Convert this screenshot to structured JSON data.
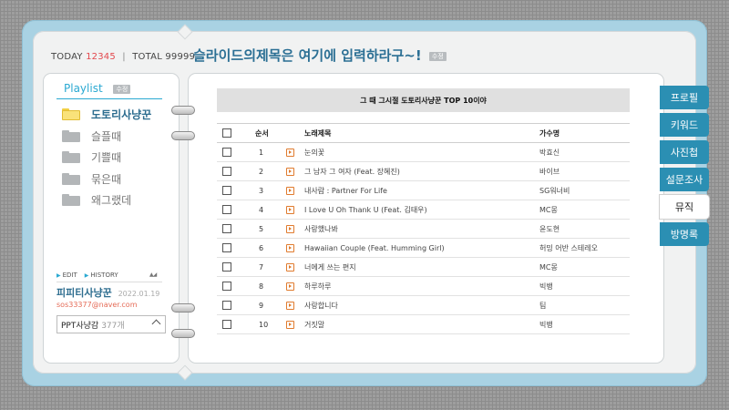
{
  "counter": {
    "today_label": "TODAY",
    "today_value": "12345",
    "separator": "|",
    "total_label": "TOTAL",
    "total_value": "99999"
  },
  "header": {
    "title": "슬라이드의제목은 여기에 입력하라구~!",
    "edit_badge": "수정"
  },
  "sidebar": {
    "playlist_title": "Playlist",
    "edit_badge": "수정",
    "folders": [
      {
        "label": "도토리사냥꾼",
        "active": true
      },
      {
        "label": "슬플때",
        "active": false
      },
      {
        "label": "기쁠때",
        "active": false
      },
      {
        "label": "묶은때",
        "active": false
      },
      {
        "label": "왜그랬데",
        "active": false
      }
    ],
    "links": {
      "edit": "EDIT",
      "history": "HISTORY"
    },
    "profile": {
      "name": "피피티사냥꾼",
      "date": "2022.01.19",
      "email": "sos33377@naver.com"
    },
    "dropdown": {
      "label": "PPT사냥감",
      "count": "377개"
    }
  },
  "main": {
    "header": "그 때 그시절 도토리사냥꾼 TOP 10이야",
    "columns": {
      "num": "순서",
      "title": "노래제목",
      "artist": "가수명"
    },
    "songs": [
      {
        "num": "1",
        "title": "눈의꽃",
        "artist": "박효신"
      },
      {
        "num": "2",
        "title": "그 남자 그 여자 (Feat. 장혜진)",
        "artist": "바이브"
      },
      {
        "num": "3",
        "title": "내사람 : Partner For Life",
        "artist": "SG워너비"
      },
      {
        "num": "4",
        "title": "I Love U Oh Thank U (Feat. 김태우)",
        "artist": "MC몽"
      },
      {
        "num": "5",
        "title": "사랑했나봐",
        "artist": "윤도현"
      },
      {
        "num": "6",
        "title": "Hawaiian Couple (Feat. Humming Girl)",
        "artist": "허밍 어반 스테레오"
      },
      {
        "num": "7",
        "title": "너에게 쓰는 편지",
        "artist": "MC몽"
      },
      {
        "num": "8",
        "title": "하루하루",
        "artist": "빅뱅"
      },
      {
        "num": "9",
        "title": "사랑합니다",
        "artist": "팀"
      },
      {
        "num": "10",
        "title": "거짓말",
        "artist": "빅뱅"
      }
    ]
  },
  "tabs": [
    {
      "label": "프로필",
      "active": false
    },
    {
      "label": "키워드",
      "active": false
    },
    {
      "label": "사진첩",
      "active": false
    },
    {
      "label": "설문조사",
      "active": false
    },
    {
      "label": "뮤직",
      "active": true
    },
    {
      "label": "방명록",
      "active": false
    }
  ],
  "icons": {
    "folder_active": "folder-yellow-icon",
    "folder": "folder-gray-icon",
    "play": "play-icon",
    "checkbox": "checkbox",
    "chevron": "chevron-up-icon"
  },
  "colors": {
    "accent": "#2aa9d2",
    "tab": "#2b8fb3",
    "frame": "#a9d2e3",
    "today": "#e3484d",
    "email": "#e56b57",
    "play": "#e07b2e"
  }
}
